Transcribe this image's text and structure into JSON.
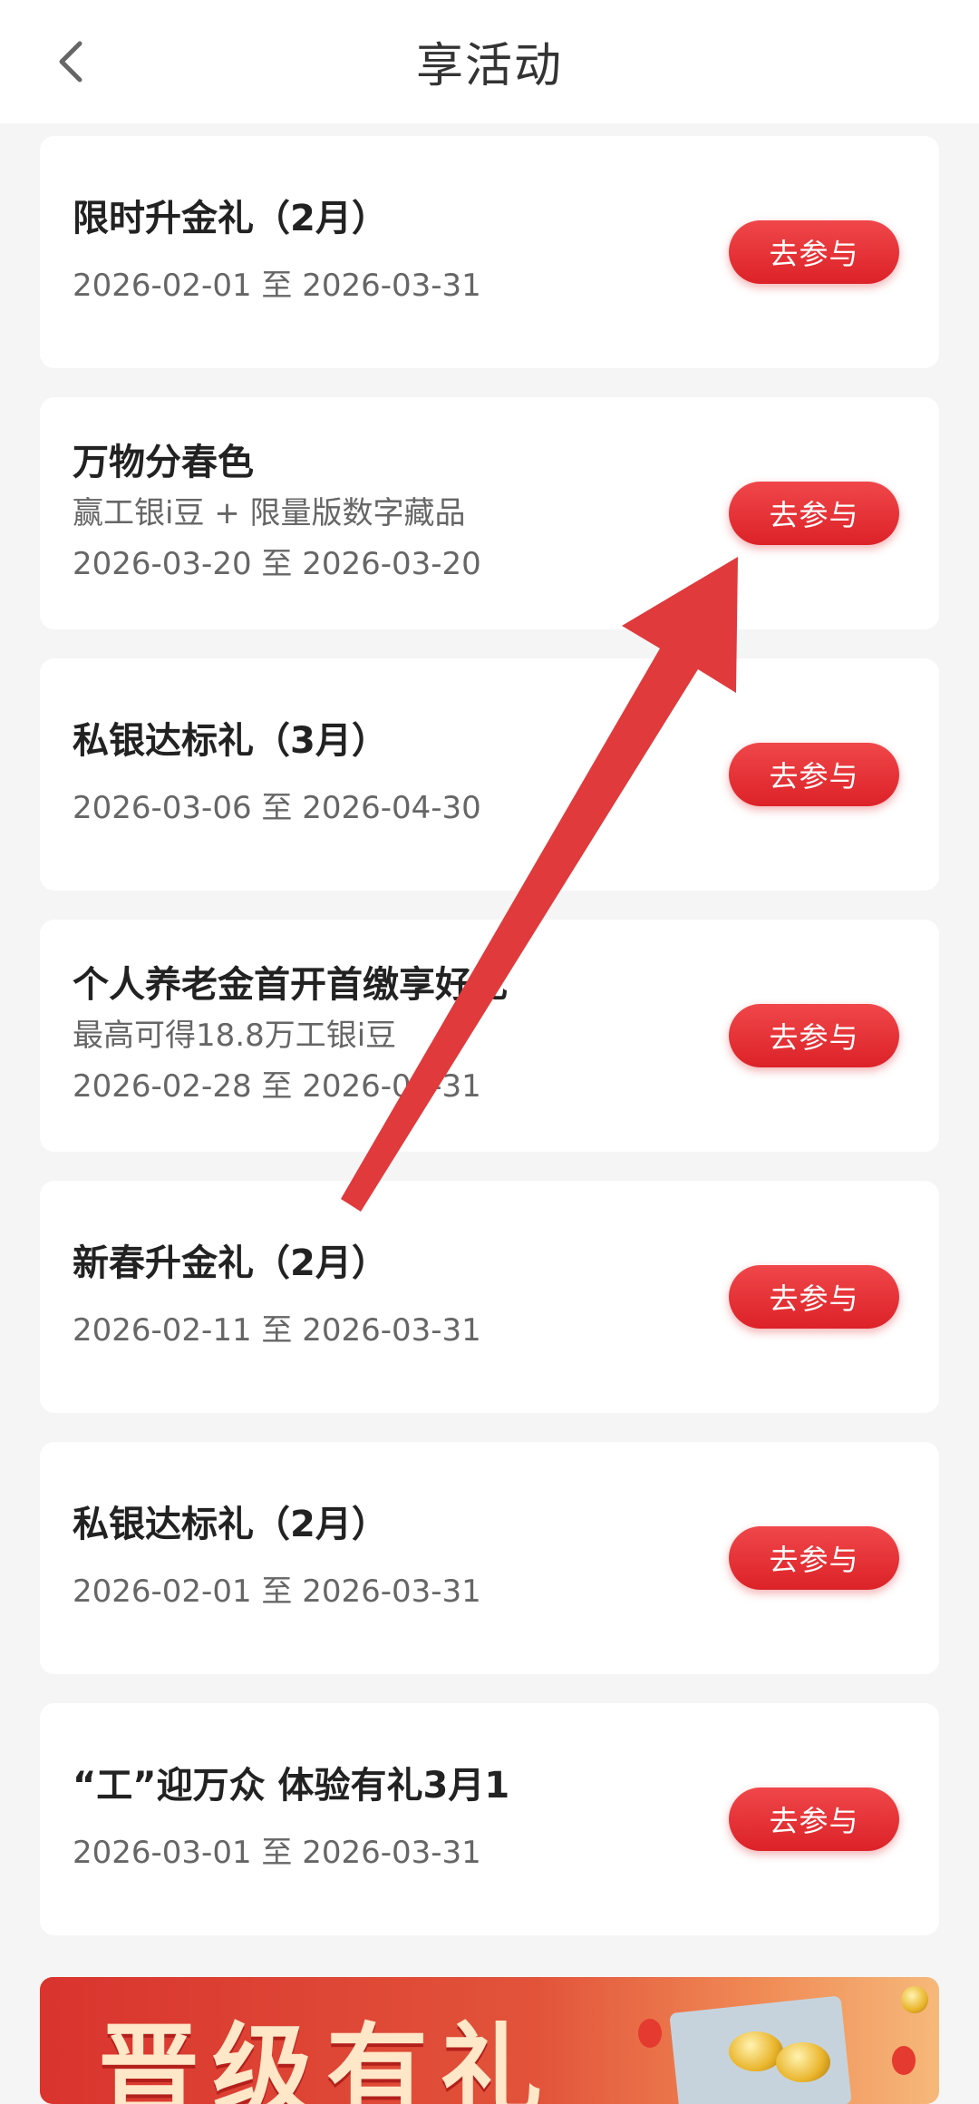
{
  "header": {
    "title": "享活动"
  },
  "activities": [
    {
      "name": "限时升金礼（2月）",
      "desc": "",
      "date": "2026-02-01 至 2026-03-31",
      "button": "去参与"
    },
    {
      "name": "万物分春色",
      "desc": "赢工银i豆 + 限量版数字藏品",
      "date": "2026-03-20 至 2026-03-20",
      "button": "去参与"
    },
    {
      "name": "私银达标礼（3月）",
      "desc": "",
      "date": "2026-03-06 至 2026-04-30",
      "button": "去参与"
    },
    {
      "name": "个人养老金首开首缴享好礼",
      "desc": "最高可得18.8万工银i豆",
      "date": "2026-02-28 至 2026-07-31",
      "button": "去参与"
    },
    {
      "name": "新春升金礼（2月）",
      "desc": "",
      "date": "2026-02-11 至 2026-03-31",
      "button": "去参与"
    },
    {
      "name": "私银达标礼（2月）",
      "desc": "",
      "date": "2026-02-01 至 2026-03-31",
      "button": "去参与"
    },
    {
      "name": "“工”迎万众 体验有礼3月1",
      "desc": "",
      "date": "2026-03-01 至 2026-03-31",
      "button": "去参与"
    }
  ],
  "banner": {
    "text": "晋级有礼"
  },
  "colors": {
    "accent": "#e0262c",
    "annotation_arrow": "#e03a3c"
  }
}
